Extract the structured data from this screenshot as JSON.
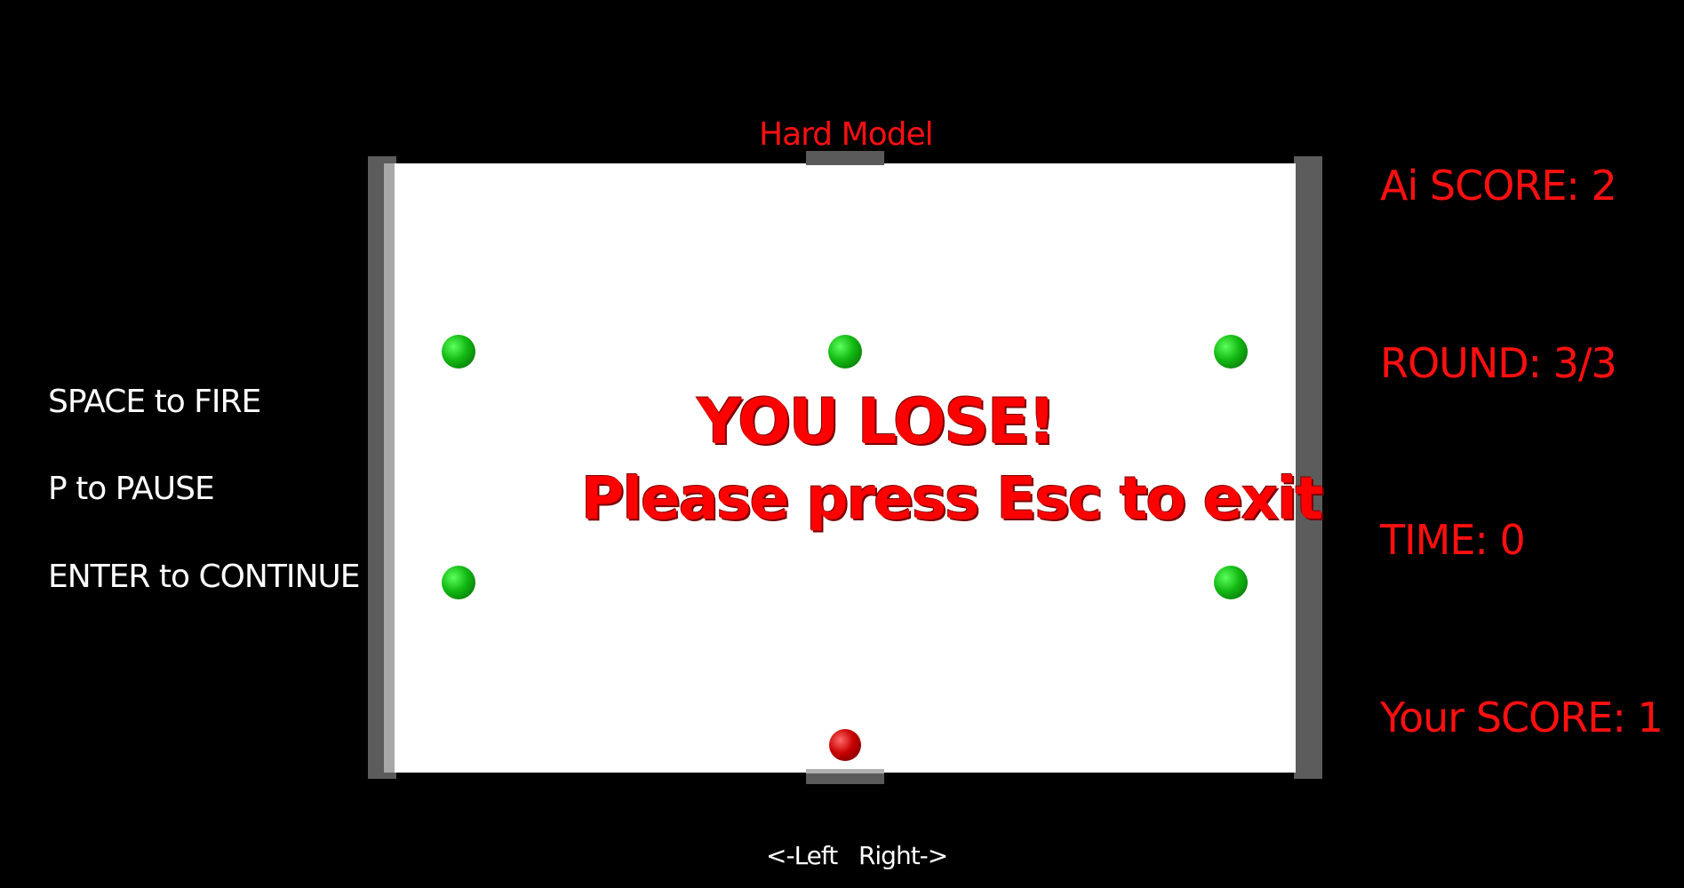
{
  "difficulty_label": "Hard Model",
  "controls": {
    "fire": "SPACE to FIRE",
    "pause": "P to PAUSE",
    "continue": "ENTER to CONTINUE",
    "move": "<-Left   Right->"
  },
  "scoreboard": {
    "ai_score": "Ai SCORE: 2",
    "round": "ROUND: 3/3",
    "time": "TIME: 0",
    "your_score": "Your SCORE: 1"
  },
  "result": {
    "title": "YOU LOSE!",
    "subtitle": "Please press Esc to exit"
  },
  "colors": {
    "hud_text": "#ff1010",
    "table": "#ffffff",
    "wall": "#5c5c5c",
    "target_ball": "#12b812",
    "player_ball": "#c80000"
  }
}
